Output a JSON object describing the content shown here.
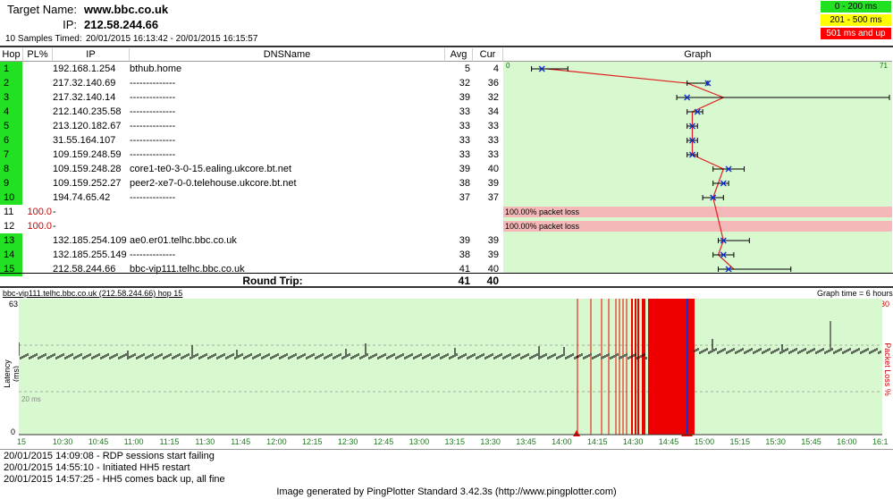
{
  "header": {
    "target_label": "Target Name:",
    "target_value": "www.bbc.co.uk",
    "ip_label": "IP:",
    "ip_value": "212.58.244.66",
    "samples_label": "10 Samples Timed:",
    "samples_value": "20/01/2015 16:13:42 - 20/01/2015 16:15:57"
  },
  "legend": [
    {
      "label": "0 - 200 ms",
      "color": "#22e022",
      "text_color": "#000000"
    },
    {
      "label": "201 - 500 ms",
      "color": "#ffff00",
      "text_color": "#000000"
    },
    {
      "label": "501 ms and up",
      "color": "#ff0000",
      "text_color": "#ffffff"
    }
  ],
  "columns": {
    "hop": "Hop",
    "pl": "PL%",
    "ip": "IP",
    "dns": "DNSName",
    "avg": "Avg",
    "cur": "Cur",
    "graph": "Graph"
  },
  "graph_scale": {
    "min_label": "0",
    "max_label": "71",
    "max_ms": 71
  },
  "hops": [
    {
      "hop": "1",
      "pl": "",
      "ip": "192.168.1.254",
      "dns": "bthub.home",
      "avg": "5",
      "cur": "4",
      "loss": false,
      "min": 2,
      "max": 9
    },
    {
      "hop": "2",
      "pl": "",
      "ip": "217.32.140.69",
      "dns": "--------------",
      "avg": "32",
      "cur": "36",
      "loss": false,
      "min": 32,
      "max": 36
    },
    {
      "hop": "3",
      "pl": "",
      "ip": "217.32.140.14",
      "dns": "--------------",
      "avg": "39",
      "cur": "32",
      "loss": false,
      "min": 30,
      "max": 71
    },
    {
      "hop": "4",
      "pl": "",
      "ip": "212.140.235.58",
      "dns": "--------------",
      "avg": "33",
      "cur": "34",
      "loss": false,
      "min": 32,
      "max": 35
    },
    {
      "hop": "5",
      "pl": "",
      "ip": "213.120.182.67",
      "dns": "--------------",
      "avg": "33",
      "cur": "33",
      "loss": false,
      "min": 32,
      "max": 34
    },
    {
      "hop": "6",
      "pl": "",
      "ip": "31.55.164.107",
      "dns": "--------------",
      "avg": "33",
      "cur": "33",
      "loss": false,
      "min": 32,
      "max": 34
    },
    {
      "hop": "7",
      "pl": "",
      "ip": "109.159.248.59",
      "dns": "--------------",
      "avg": "33",
      "cur": "33",
      "loss": false,
      "min": 32,
      "max": 34
    },
    {
      "hop": "8",
      "pl": "",
      "ip": "109.159.248.28",
      "dns": "core1-te0-3-0-15.ealing.ukcore.bt.net",
      "avg": "39",
      "cur": "40",
      "loss": false,
      "min": 37,
      "max": 43
    },
    {
      "hop": "9",
      "pl": "",
      "ip": "109.159.252.27",
      "dns": "peer2-xe7-0-0.telehouse.ukcore.bt.net",
      "avg": "38",
      "cur": "39",
      "loss": false,
      "min": 37,
      "max": 40
    },
    {
      "hop": "10",
      "pl": "",
      "ip": "194.74.65.42",
      "dns": "--------------",
      "avg": "37",
      "cur": "37",
      "loss": false,
      "min": 35,
      "max": 39
    },
    {
      "hop": "11",
      "pl": "100.0",
      "ip": "-",
      "dns": "",
      "avg": "",
      "cur": "",
      "loss": true,
      "loss_text": "100.00% packet loss"
    },
    {
      "hop": "12",
      "pl": "100.0",
      "ip": "-",
      "dns": "",
      "avg": "",
      "cur": "",
      "loss": true,
      "loss_text": "100.00% packet loss"
    },
    {
      "hop": "13",
      "pl": "",
      "ip": "132.185.254.109",
      "dns": "ae0.er01.telhc.bbc.co.uk",
      "avg": "39",
      "cur": "39",
      "loss": false,
      "min": 38,
      "max": 44
    },
    {
      "hop": "14",
      "pl": "",
      "ip": "132.185.255.149",
      "dns": "--------------",
      "avg": "38",
      "cur": "39",
      "loss": false,
      "min": 37,
      "max": 41
    },
    {
      "hop": "15",
      "pl": "",
      "ip": "212.58.244.66",
      "dns": "bbc-vip111.telhc.bbc.co.uk",
      "avg": "41",
      "cur": "40",
      "loss": false,
      "min": 38,
      "max": 52
    }
  ],
  "round_trip": {
    "label": "Round Trip:",
    "avg": "41",
    "cur": "40"
  },
  "timeline": {
    "title": "bbc-vip111.telhc.bbc.co.uk (212.58.244.66) hop 15",
    "graph_time": "Graph time = 6 hours",
    "y_max": "63",
    "y_min": "0",
    "y_axis_label": "Latency (ms)",
    "mid_label": "20 ms",
    "right_max": "30",
    "right_axis_label": "Packet Loss %",
    "ticks": [
      "15",
      "10:30",
      "10:45",
      "11:00",
      "11:15",
      "11:30",
      "11:45",
      "12:00",
      "12:15",
      "12:30",
      "12:45",
      "13:00",
      "13:15",
      "13:30",
      "13:45",
      "14:00",
      "14:15",
      "14:30",
      "14:45",
      "15:00",
      "15:15",
      "15:30",
      "15:45",
      "16:00",
      "16:1"
    ]
  },
  "notes": [
    "20/01/2015 14:09:08 - RDP sessions start failing",
    "20/01/2015 14:55:10 - Initiated HH5 restart",
    "20/01/2015 14:57:25 - HH5 comes back up, all fine"
  ],
  "footer": "Image generated by PingPlotter Standard 3.42.3s (http://www.pingplotter.com)"
}
